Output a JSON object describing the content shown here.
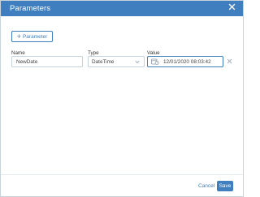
{
  "dialog": {
    "title": "Parameters",
    "close_icon": "close-icon"
  },
  "toolbar": {
    "add_label": "Parameter",
    "add_icon": "plus-icon"
  },
  "table": {
    "headers": {
      "name": "Name",
      "type": "Type",
      "value": "Value"
    },
    "rows": [
      {
        "name": "NewDate",
        "type": "DateTime",
        "value": "12/01/2020 08:03:42"
      }
    ]
  },
  "footer": {
    "cancel_label": "Cancel",
    "save_label": "Save"
  },
  "colors": {
    "accent": "#3f7fc0",
    "border": "#c5d3de"
  }
}
